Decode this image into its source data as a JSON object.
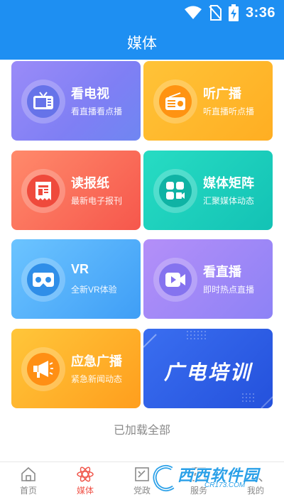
{
  "status": {
    "time": "3:36"
  },
  "header": {
    "title": "媒体"
  },
  "cards": [
    {
      "title": "看电视",
      "subtitle": "看直播看点播",
      "icon": "tv-icon"
    },
    {
      "title": "听广播",
      "subtitle": "听直播听点播",
      "icon": "radio-icon"
    },
    {
      "title": "读报纸",
      "subtitle": "最新电子报刊",
      "icon": "newspaper-icon"
    },
    {
      "title": "媒体矩阵",
      "subtitle": "汇聚媒体动态",
      "icon": "media-matrix-icon"
    },
    {
      "title": "VR",
      "subtitle": "全新VR体验",
      "icon": "vr-headset-icon"
    },
    {
      "title": "看直播",
      "subtitle": "即时热点直播",
      "icon": "live-video-icon"
    },
    {
      "title": "应急广播",
      "subtitle": "紧急新闻动态",
      "icon": "megaphone-icon"
    },
    {
      "title": "广电培训"
    }
  ],
  "footer_text": "已加载全部",
  "tabs": [
    {
      "label": "首页",
      "icon": "home-icon",
      "active": false
    },
    {
      "label": "媒体",
      "icon": "media-icon",
      "active": true
    },
    {
      "label": "党政",
      "icon": "party-icon",
      "active": false
    },
    {
      "label": "服务",
      "icon": "service-icon",
      "active": false
    },
    {
      "label": "我的",
      "icon": "profile-icon",
      "active": false
    }
  ],
  "watermark": {
    "text": "西西软件园",
    "url": "CR173.COM"
  },
  "colors": {
    "primary": "#1e8ff2",
    "active_tab": "#f0554a"
  }
}
